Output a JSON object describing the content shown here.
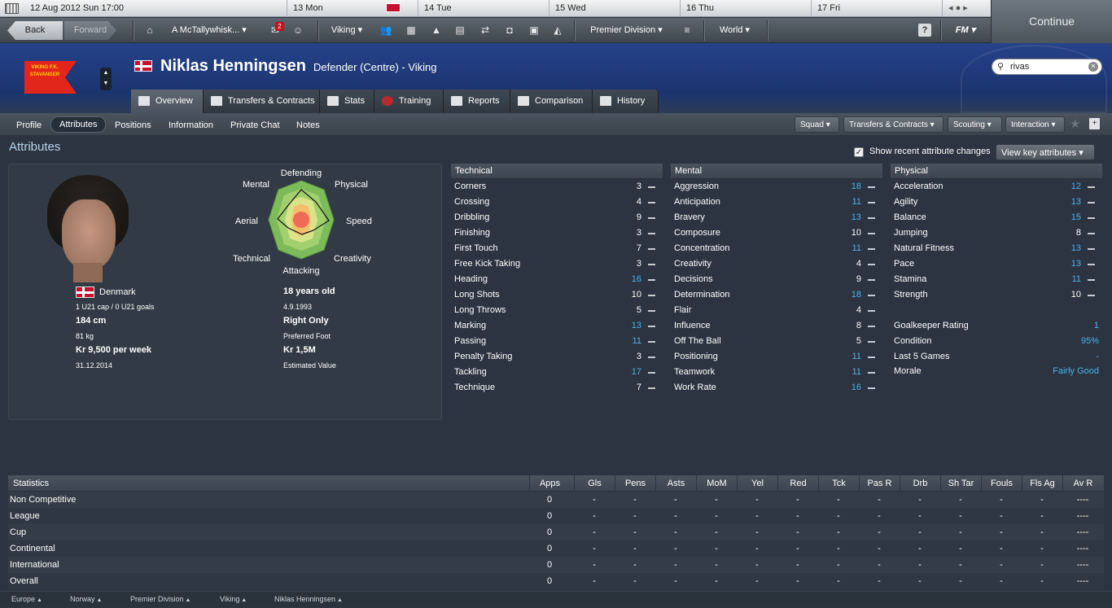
{
  "topbar": {
    "date": "12 Aug 2012 Sun 17:00",
    "days": [
      "13 Mon",
      "14 Tue",
      "15 Wed",
      "16 Thu",
      "17 Fri"
    ],
    "continue_label": "Continue"
  },
  "nav": {
    "back": "Back",
    "forward": "Forward",
    "manager": "A McTallywhisk...",
    "inbox_badge": "2",
    "club": "Viking",
    "competition": "Premier Division",
    "world": "World",
    "fm": "FM",
    "help": "?"
  },
  "player": {
    "name": "Niklas Henningsen",
    "role": "Defender (Centre) - Viking",
    "club_crest": "VIKING F.K. STAVANGER",
    "nationality": "Denmark",
    "caps": "1 U21 cap / 0 U21 goals",
    "height": "184 cm",
    "weight": "81 kg",
    "wage": "Kr 9,500 per week",
    "contract_end": "31.12.2014",
    "age": "18 years old",
    "dob": "4.9.1993",
    "foot": "Right Only",
    "foot_label": "Preferred Foot",
    "value": "Kr 1,5M",
    "value_label": "Estimated Value"
  },
  "search": {
    "value": "rivas"
  },
  "tabs": [
    "Overview",
    "Transfers & Contracts",
    "Stats",
    "Training",
    "Reports",
    "Comparison",
    "History"
  ],
  "subnav": [
    "Profile",
    "Attributes",
    "Positions",
    "Information",
    "Private Chat",
    "Notes"
  ],
  "dropdowns": [
    "Squad",
    "Transfers & Contracts",
    "Scouting",
    "Interaction"
  ],
  "section_title": "Attributes",
  "show_changes_label": "Show recent attribute changes",
  "key_attr_button": "View key attributes",
  "radar": {
    "labels": [
      "Defending",
      "Physical",
      "Speed",
      "Creativity",
      "Attacking",
      "Technical",
      "Aerial",
      "Mental"
    ]
  },
  "technical": {
    "title": "Technical",
    "items": [
      {
        "name": "Corners",
        "value": "3",
        "hl": false
      },
      {
        "name": "Crossing",
        "value": "4",
        "hl": false
      },
      {
        "name": "Dribbling",
        "value": "9",
        "hl": false
      },
      {
        "name": "Finishing",
        "value": "3",
        "hl": false
      },
      {
        "name": "First Touch",
        "value": "7",
        "hl": false
      },
      {
        "name": "Free Kick Taking",
        "value": "3",
        "hl": false
      },
      {
        "name": "Heading",
        "value": "16",
        "hl": true
      },
      {
        "name": "Long Shots",
        "value": "10",
        "hl": false
      },
      {
        "name": "Long Throws",
        "value": "5",
        "hl": false
      },
      {
        "name": "Marking",
        "value": "13",
        "hl": true
      },
      {
        "name": "Passing",
        "value": "11",
        "hl": true
      },
      {
        "name": "Penalty Taking",
        "value": "3",
        "hl": false
      },
      {
        "name": "Tackling",
        "value": "17",
        "hl": true
      },
      {
        "name": "Technique",
        "value": "7",
        "hl": false
      }
    ]
  },
  "mental": {
    "title": "Mental",
    "items": [
      {
        "name": "Aggression",
        "value": "18",
        "hl": true
      },
      {
        "name": "Anticipation",
        "value": "11",
        "hl": true
      },
      {
        "name": "Bravery",
        "value": "13",
        "hl": true
      },
      {
        "name": "Composure",
        "value": "10",
        "hl": false
      },
      {
        "name": "Concentration",
        "value": "11",
        "hl": true
      },
      {
        "name": "Creativity",
        "value": "4",
        "hl": false
      },
      {
        "name": "Decisions",
        "value": "9",
        "hl": false
      },
      {
        "name": "Determination",
        "value": "18",
        "hl": true
      },
      {
        "name": "Flair",
        "value": "4",
        "hl": false
      },
      {
        "name": "Influence",
        "value": "8",
        "hl": false
      },
      {
        "name": "Off The Ball",
        "value": "5",
        "hl": false
      },
      {
        "name": "Positioning",
        "value": "11",
        "hl": true
      },
      {
        "name": "Teamwork",
        "value": "11",
        "hl": true
      },
      {
        "name": "Work Rate",
        "value": "16",
        "hl": true
      }
    ]
  },
  "physical": {
    "title": "Physical",
    "items": [
      {
        "name": "Acceleration",
        "value": "12",
        "hl": true
      },
      {
        "name": "Agility",
        "value": "13",
        "hl": true
      },
      {
        "name": "Balance",
        "value": "15",
        "hl": true
      },
      {
        "name": "Jumping",
        "value": "8",
        "hl": false
      },
      {
        "name": "Natural Fitness",
        "value": "13",
        "hl": true
      },
      {
        "name": "Pace",
        "value": "13",
        "hl": true
      },
      {
        "name": "Stamina",
        "value": "11",
        "hl": true
      },
      {
        "name": "Strength",
        "value": "10",
        "hl": false
      }
    ],
    "extra": [
      {
        "name": "Goalkeeper Rating",
        "value": "1"
      },
      {
        "name": "Condition",
        "value": "95%"
      },
      {
        "name": "Last 5 Games",
        "value": "-"
      },
      {
        "name": "Morale",
        "value": "Fairly Good"
      }
    ]
  },
  "stats": {
    "title": "Statistics",
    "columns": [
      "Apps",
      "Gls",
      "Pens",
      "Asts",
      "MoM",
      "Yel",
      "Red",
      "Tck",
      "Pas R",
      "Drb",
      "Sh Tar",
      "Fouls",
      "Fls Ag",
      "Av R"
    ],
    "rows": [
      {
        "label": "Non Competitive",
        "cells": [
          "0",
          "-",
          "-",
          "-",
          "-",
          "-",
          "-",
          "-",
          "-",
          "-",
          "-",
          "-",
          "-",
          "----"
        ]
      },
      {
        "label": "League",
        "cells": [
          "0",
          "-",
          "-",
          "-",
          "-",
          "-",
          "-",
          "-",
          "-",
          "-",
          "-",
          "-",
          "-",
          "----"
        ]
      },
      {
        "label": "Cup",
        "cells": [
          "0",
          "-",
          "-",
          "-",
          "-",
          "-",
          "-",
          "-",
          "-",
          "-",
          "-",
          "-",
          "-",
          "----"
        ]
      },
      {
        "label": "Continental",
        "cells": [
          "0",
          "-",
          "-",
          "-",
          "-",
          "-",
          "-",
          "-",
          "-",
          "-",
          "-",
          "-",
          "-",
          "----"
        ]
      },
      {
        "label": "International",
        "cells": [
          "0",
          "-",
          "-",
          "-",
          "-",
          "-",
          "-",
          "-",
          "-",
          "-",
          "-",
          "-",
          "-",
          "----"
        ]
      },
      {
        "label": "Overall",
        "cells": [
          "0",
          "-",
          "-",
          "-",
          "-",
          "-",
          "-",
          "-",
          "-",
          "-",
          "-",
          "-",
          "-",
          "----"
        ]
      }
    ]
  },
  "breadcrumbs": [
    "Europe",
    "Norway",
    "Premier Division",
    "Viking",
    "Niklas Henningsen"
  ]
}
